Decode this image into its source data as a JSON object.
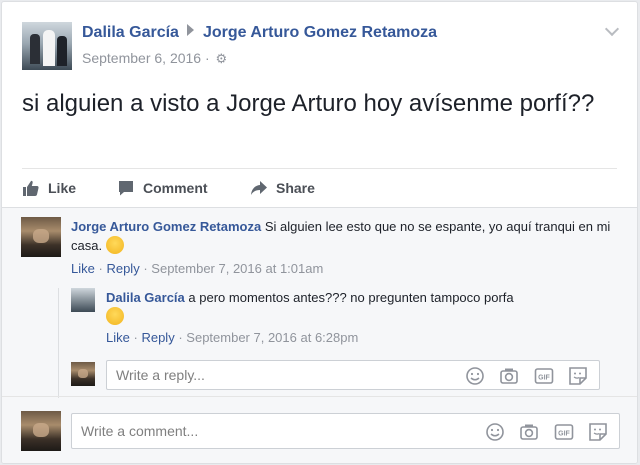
{
  "post": {
    "author": "Dalila García",
    "target": "Jorge Arturo Gomez Retamoza",
    "date": "September 6, 2016",
    "date_sep": "·",
    "text": "si alguien a visto a Jorge Arturo hoy avísenme porfí??"
  },
  "actions": {
    "like": "Like",
    "comment": "Comment",
    "share": "Share"
  },
  "comments": [
    {
      "author": "Jorge Arturo Gomez Retamoza",
      "text": "Si alguien lee esto que no se espante, yo aquí tranqui en mi casa.",
      "like": "Like",
      "reply": "Reply",
      "dot": "·",
      "time": "September 7, 2016 at 1:01am"
    },
    {
      "author": "Dalila García",
      "text": "a pero momentos antes??? no pregunten tampoco porfa",
      "like": "Like",
      "reply": "Reply",
      "dot": "·",
      "time": "September 7, 2016 at 6:28pm"
    }
  ],
  "reply_input": {
    "placeholder": "Write a reply..."
  },
  "comment_input": {
    "placeholder": "Write a comment..."
  },
  "icons": {
    "emoji": "smiley-icon",
    "camera": "camera-icon",
    "gif": "gif-icon",
    "sticker": "sticker-icon",
    "gif_label": "GIF"
  },
  "colors": {
    "link": "#365899",
    "meta": "#90949c",
    "text": "#1d2129"
  }
}
